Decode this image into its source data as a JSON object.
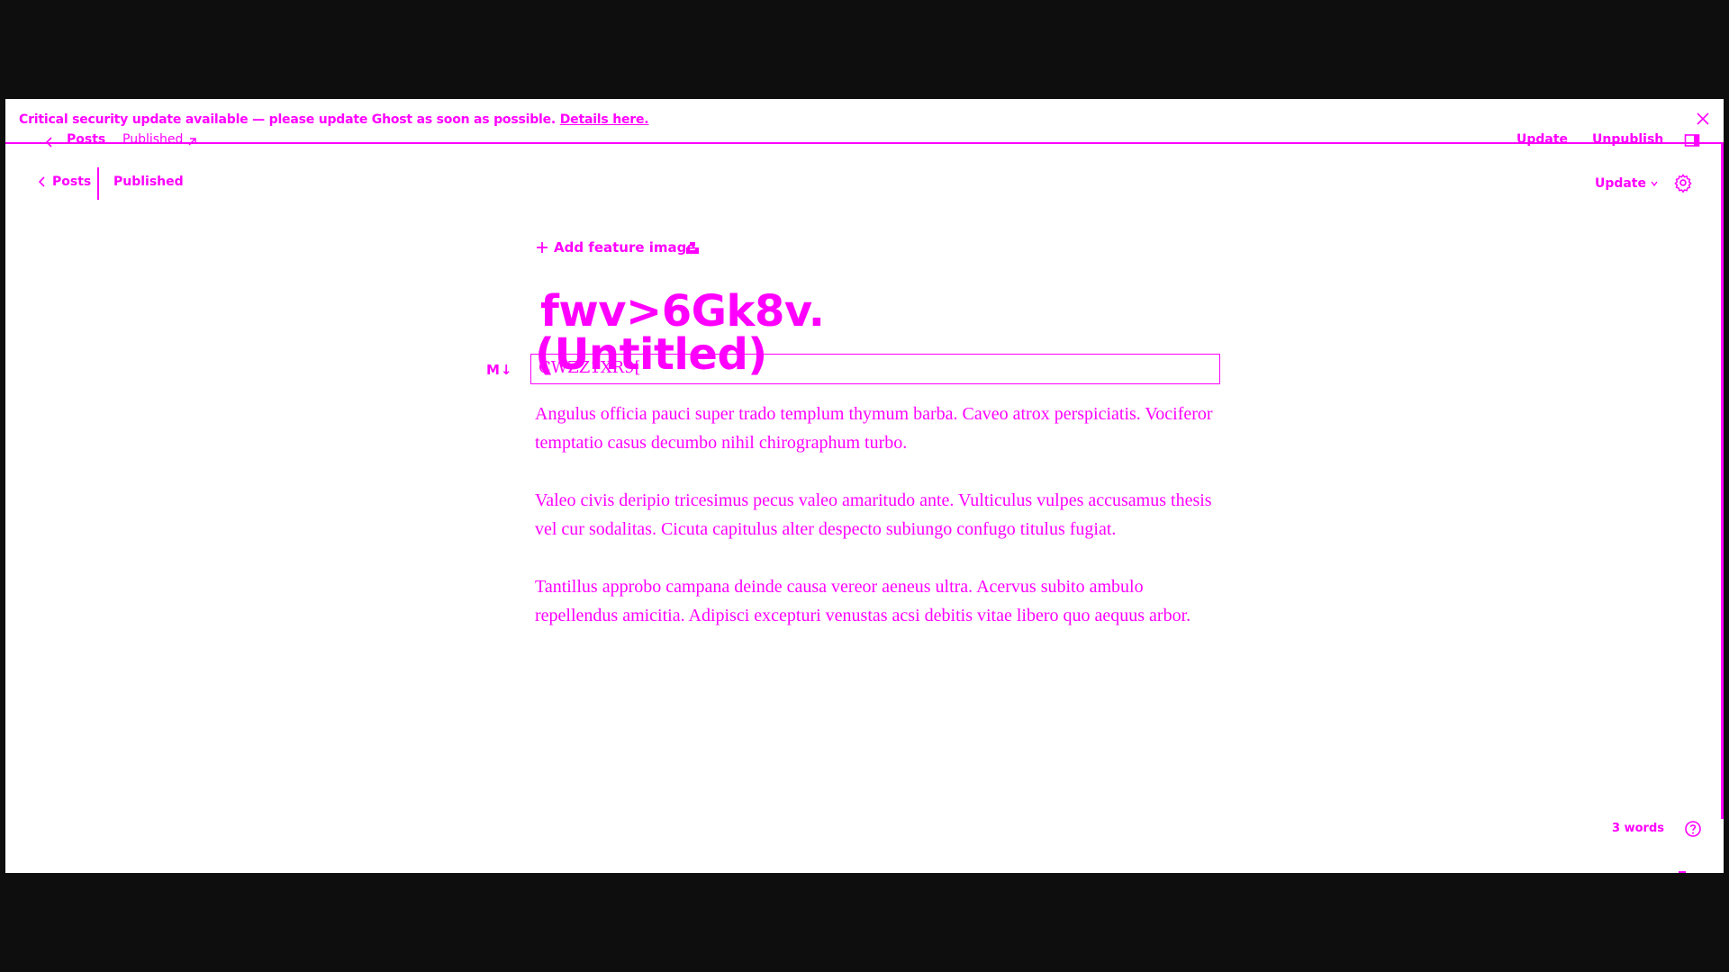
{
  "theme": {
    "accent": "#ff00ff",
    "background": "#ffffff",
    "frame": "#0e0e0f"
  },
  "notification": {
    "message": "Critical security update available — please update Ghost as soon as possible.",
    "link_label": "Details here.",
    "close_icon": "close-icon"
  },
  "ghost_header": {
    "posts_label": "Posts",
    "status_label": "Published",
    "update_label": "Update",
    "unpublish_label": "Unpublish",
    "sidebar_icon": "sidebar-toggle-icon"
  },
  "header": {
    "back_label": "Posts",
    "status_label": "Published",
    "update_label": "Update",
    "settings_icon": "gear-icon"
  },
  "editor": {
    "feature_image_label": "Add feature image",
    "unsplash_icon": "unsplash-icon",
    "title_text": "fwv>6Gk8v.",
    "title_placeholder": "(Untitled)",
    "markdown_badge": "M↓",
    "excerpt_text": "CWZZ1XR9[",
    "paragraphs": [
      "Angulus officia pauci super trado templum thymum barba. Caveo atrox perspiciatis. Vociferor temptatio casus decumbo nihil chirographum turbo.",
      "Valeo civis deripio tricesimus pecus valeo amaritudo ante. Vulticulus vulpes accusamus thesis vel cur sodalitas. Cicuta capitulus alter despecto subiungo confugo titulus fugiat.",
      "Tantillus approbo campana deinde causa vereor aeneus ultra. Acervus subito ambulo repellendus amicitia. Adipisci excepturi venustas acsi debitis vitae libero quo aequus arbor."
    ]
  },
  "footer": {
    "word_count": "3 words",
    "help_icon": "help-icon"
  }
}
